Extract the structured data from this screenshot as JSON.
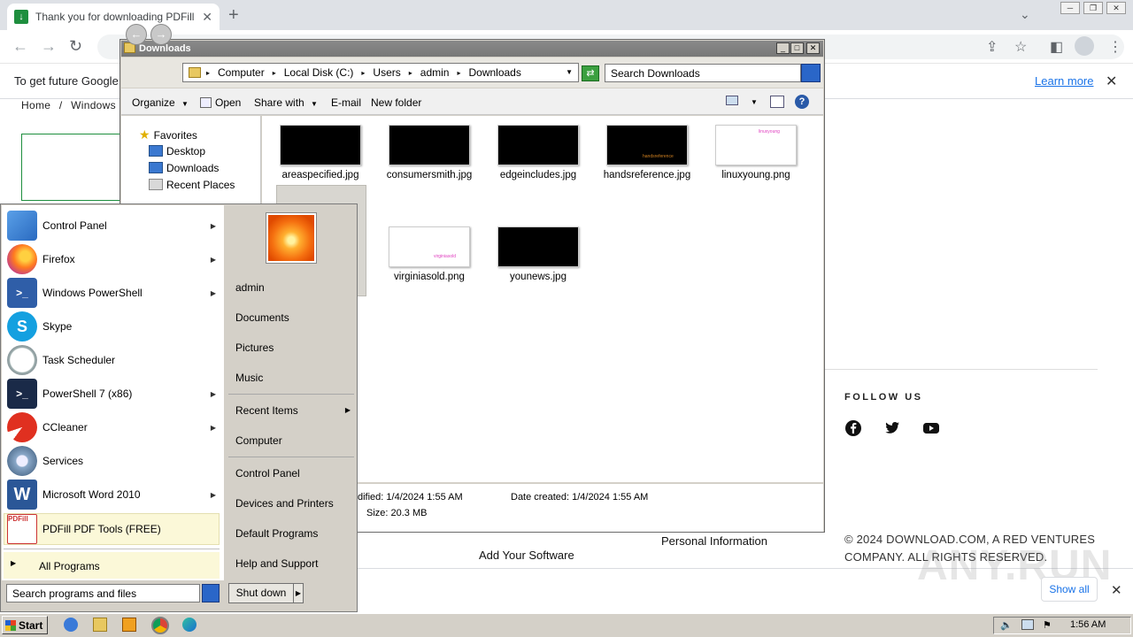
{
  "browser": {
    "tab_title": "Thank you for downloading PDFill Free",
    "new_tab": "+",
    "tab_close": "✕",
    "infobar_text": "To get future Google",
    "learn_more": "Learn more",
    "breadcrumb": [
      "Home",
      "/",
      "Windows"
    ]
  },
  "page": {
    "follow_us": "FOLLOW US",
    "copyright_line1": "© 2024 DOWNLOAD.COM, A RED VENTURES",
    "copyright_line2": "COMPANY. ALL RIGHTS RESERVED.",
    "personal_info": "Personal Information",
    "add_software": "Add Your Software",
    "show_all": "Show all",
    "watermark": "ANY.RUN",
    "social_icons": [
      "facebook-icon",
      "twitter-icon",
      "youtube-icon"
    ]
  },
  "explorer": {
    "title": "Downloads",
    "address": [
      "Computer",
      "Local Disk (C:)",
      "Users",
      "admin",
      "Downloads"
    ],
    "search_placeholder": "Search Downloads",
    "commands": {
      "organize": "Organize",
      "open": "Open",
      "share_with": "Share with",
      "email": "E-mail",
      "new_folder": "New folder"
    },
    "nav": {
      "favorites": "Favorites",
      "desktop": "Desktop",
      "downloads": "Downloads",
      "recent_places": "Recent Places"
    },
    "files": [
      {
        "name": "areaspecified.jpg",
        "thumb": "black",
        "thumb_text": ""
      },
      {
        "name": "consumersmith.jpg",
        "thumb": "black",
        "thumb_text": ""
      },
      {
        "name": "edgeincludes.jpg",
        "thumb": "black",
        "thumb_text": ""
      },
      {
        "name": "handsreference.jpg",
        "thumb": "black",
        "thumb_text": "handsreference"
      },
      {
        "name": "linuxyoung.png",
        "thumb": "white",
        "thumb_text": "linuxyoung"
      },
      {
        "name": "virginiasold.png",
        "thumb": "white",
        "thumb_text": "virginiasold"
      },
      {
        "name": "younews.jpg",
        "thumb": "black",
        "thumb_text": ""
      }
    ],
    "details": {
      "modified": "dified: 1/4/2024 1:55 AM",
      "created": "Date created: 1/4/2024 1:55 AM",
      "size": "Size: 20.3 MB"
    }
  },
  "start_menu": {
    "programs": [
      {
        "label": "Control Panel",
        "arrow": true
      },
      {
        "label": "Firefox",
        "arrow": true
      },
      {
        "label": "Windows PowerShell",
        "arrow": true
      },
      {
        "label": "Skype",
        "arrow": false
      },
      {
        "label": "Task Scheduler",
        "arrow": false
      },
      {
        "label": "PowerShell 7 (x86)",
        "arrow": true
      },
      {
        "label": "CCleaner",
        "arrow": true
      },
      {
        "label": "Services",
        "arrow": false
      },
      {
        "label": "Microsoft Word 2010",
        "arrow": true
      },
      {
        "label": "PDFill PDF Tools (FREE)",
        "arrow": false
      }
    ],
    "all_programs": "All Programs",
    "search_placeholder": "Search programs and files",
    "right": {
      "user": "admin",
      "documents": "Documents",
      "pictures": "Pictures",
      "music": "Music",
      "recent_items": "Recent Items",
      "computer": "Computer",
      "control_panel": "Control Panel",
      "devices_printers": "Devices and Printers",
      "default_programs": "Default Programs",
      "help_support": "Help and Support"
    },
    "shut_down": "Shut down"
  },
  "taskbar": {
    "start": "Start",
    "clock": "1:56 AM"
  }
}
